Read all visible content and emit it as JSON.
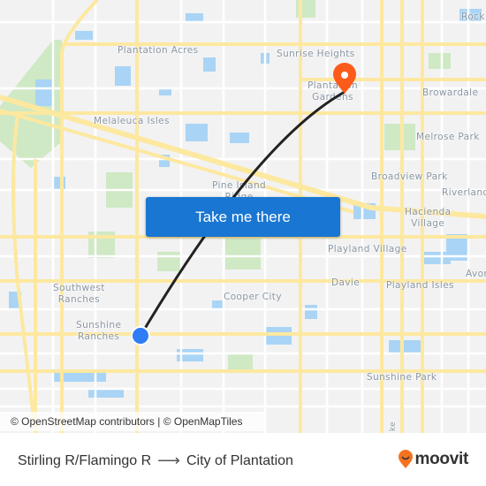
{
  "map": {
    "places": [
      {
        "id": "rock",
        "label": "Rock"
      },
      {
        "id": "plantation-acres",
        "label": "Plantation Acres"
      },
      {
        "id": "sunrise-heights",
        "label": "Sunrise Heights"
      },
      {
        "id": "plantation-gardens",
        "label": "Plantation\nGardens"
      },
      {
        "id": "browardale",
        "label": "Browardale"
      },
      {
        "id": "melaleuca-isles",
        "label": "Melaleuca Isles"
      },
      {
        "id": "melrose-park",
        "label": "Melrose Park"
      },
      {
        "id": "pine-island-ridge",
        "label": "Pine Island\nRidge"
      },
      {
        "id": "broadview-park",
        "label": "Broadview Park"
      },
      {
        "id": "riverland",
        "label": "Riverland"
      },
      {
        "id": "hacienda-village",
        "label": "Hacienda\nVillage"
      },
      {
        "id": "playland-village",
        "label": "Playland Village"
      },
      {
        "id": "davie",
        "label": "Davie"
      },
      {
        "id": "playland-isles",
        "label": "Playland Isles"
      },
      {
        "id": "avon",
        "label": "Avon"
      },
      {
        "id": "southwest-ranches",
        "label": "Southwest\nRanches"
      },
      {
        "id": "cooper-city",
        "label": "Cooper City"
      },
      {
        "id": "sunshine-ranches",
        "label": "Sunshine\nRanches"
      },
      {
        "id": "sunshine-park",
        "label": "Sunshine Park"
      }
    ],
    "road_label": "ke",
    "origin_marker": {
      "name": "Stirling R/Flamingo R",
      "color": "#2f7cf6"
    },
    "destination_marker": {
      "name": "City of Plantation",
      "color": "#fc5b1a"
    },
    "route_color": "#222222"
  },
  "cta": {
    "label": "Take me there",
    "color": "#1976d2"
  },
  "attribution": "© OpenStreetMap contributors | © OpenMapTiles",
  "footer": {
    "origin": "Stirling R/Flamingo R",
    "arrow": "⟶",
    "destination": "City of Plantation",
    "brand": "moovit",
    "brand_color": "#f4731f"
  }
}
